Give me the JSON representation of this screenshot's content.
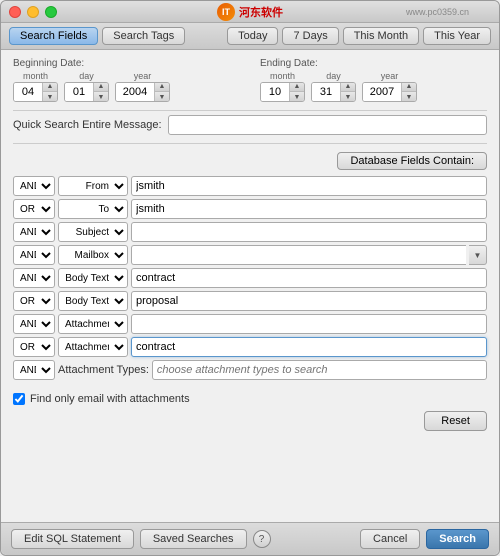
{
  "titlebar": {
    "logo_text": "河东软件",
    "watermark": "www.pc0359.cn"
  },
  "toolbar": {
    "search_fields_label": "Search Fields",
    "search_tags_label": "Search Tags",
    "today_label": "Today",
    "this_month_label": "This Month",
    "this_year_label": "This Year",
    "seven_days_label": "7 Days"
  },
  "dates": {
    "beginning_label": "Beginning Date:",
    "ending_label": "Ending Date:",
    "month_label": "month",
    "day_label": "day",
    "year_label": "year",
    "begin_month": "04",
    "begin_day": "01",
    "begin_year": "2004",
    "end_month": "10",
    "end_day": "31",
    "end_year": "2007"
  },
  "quick_search": {
    "label": "Quick Search Entire Message:",
    "placeholder": ""
  },
  "db_fields": {
    "button_label": "Database Fields Contain:"
  },
  "rows": [
    {
      "logic": "AND",
      "field": "From",
      "value": "jsmith",
      "has_dropdown": false,
      "active": false
    },
    {
      "logic": "OR",
      "field": "To",
      "value": "jsmith",
      "has_dropdown": false,
      "active": false
    },
    {
      "logic": "AND",
      "field": "Subject",
      "value": "",
      "has_dropdown": false,
      "active": false
    },
    {
      "logic": "AND",
      "field": "Mailbox",
      "value": "",
      "has_dropdown": true,
      "active": false
    },
    {
      "logic": "AND",
      "field": "Body Text",
      "value": "contract",
      "has_dropdown": false,
      "active": false
    },
    {
      "logic": "OR",
      "field": "Body Text",
      "value": "proposal",
      "has_dropdown": false,
      "active": false
    },
    {
      "logic": "AND",
      "field": "Attachment Name",
      "value": "",
      "has_dropdown": false,
      "active": false
    },
    {
      "logic": "OR",
      "field": "Attachment Contents",
      "value": "contract",
      "has_dropdown": false,
      "active": true
    }
  ],
  "attachment_types": {
    "logic": "AND",
    "field": "Attachment Types:",
    "placeholder": "choose attachment types to search"
  },
  "checkbox": {
    "label": "Find only email with attachments",
    "checked": true
  },
  "reset_btn": "Reset",
  "footer": {
    "edit_sql_label": "Edit SQL Statement",
    "saved_searches_label": "Saved Searches",
    "help_label": "?",
    "cancel_label": "Cancel",
    "search_label": "Search"
  }
}
